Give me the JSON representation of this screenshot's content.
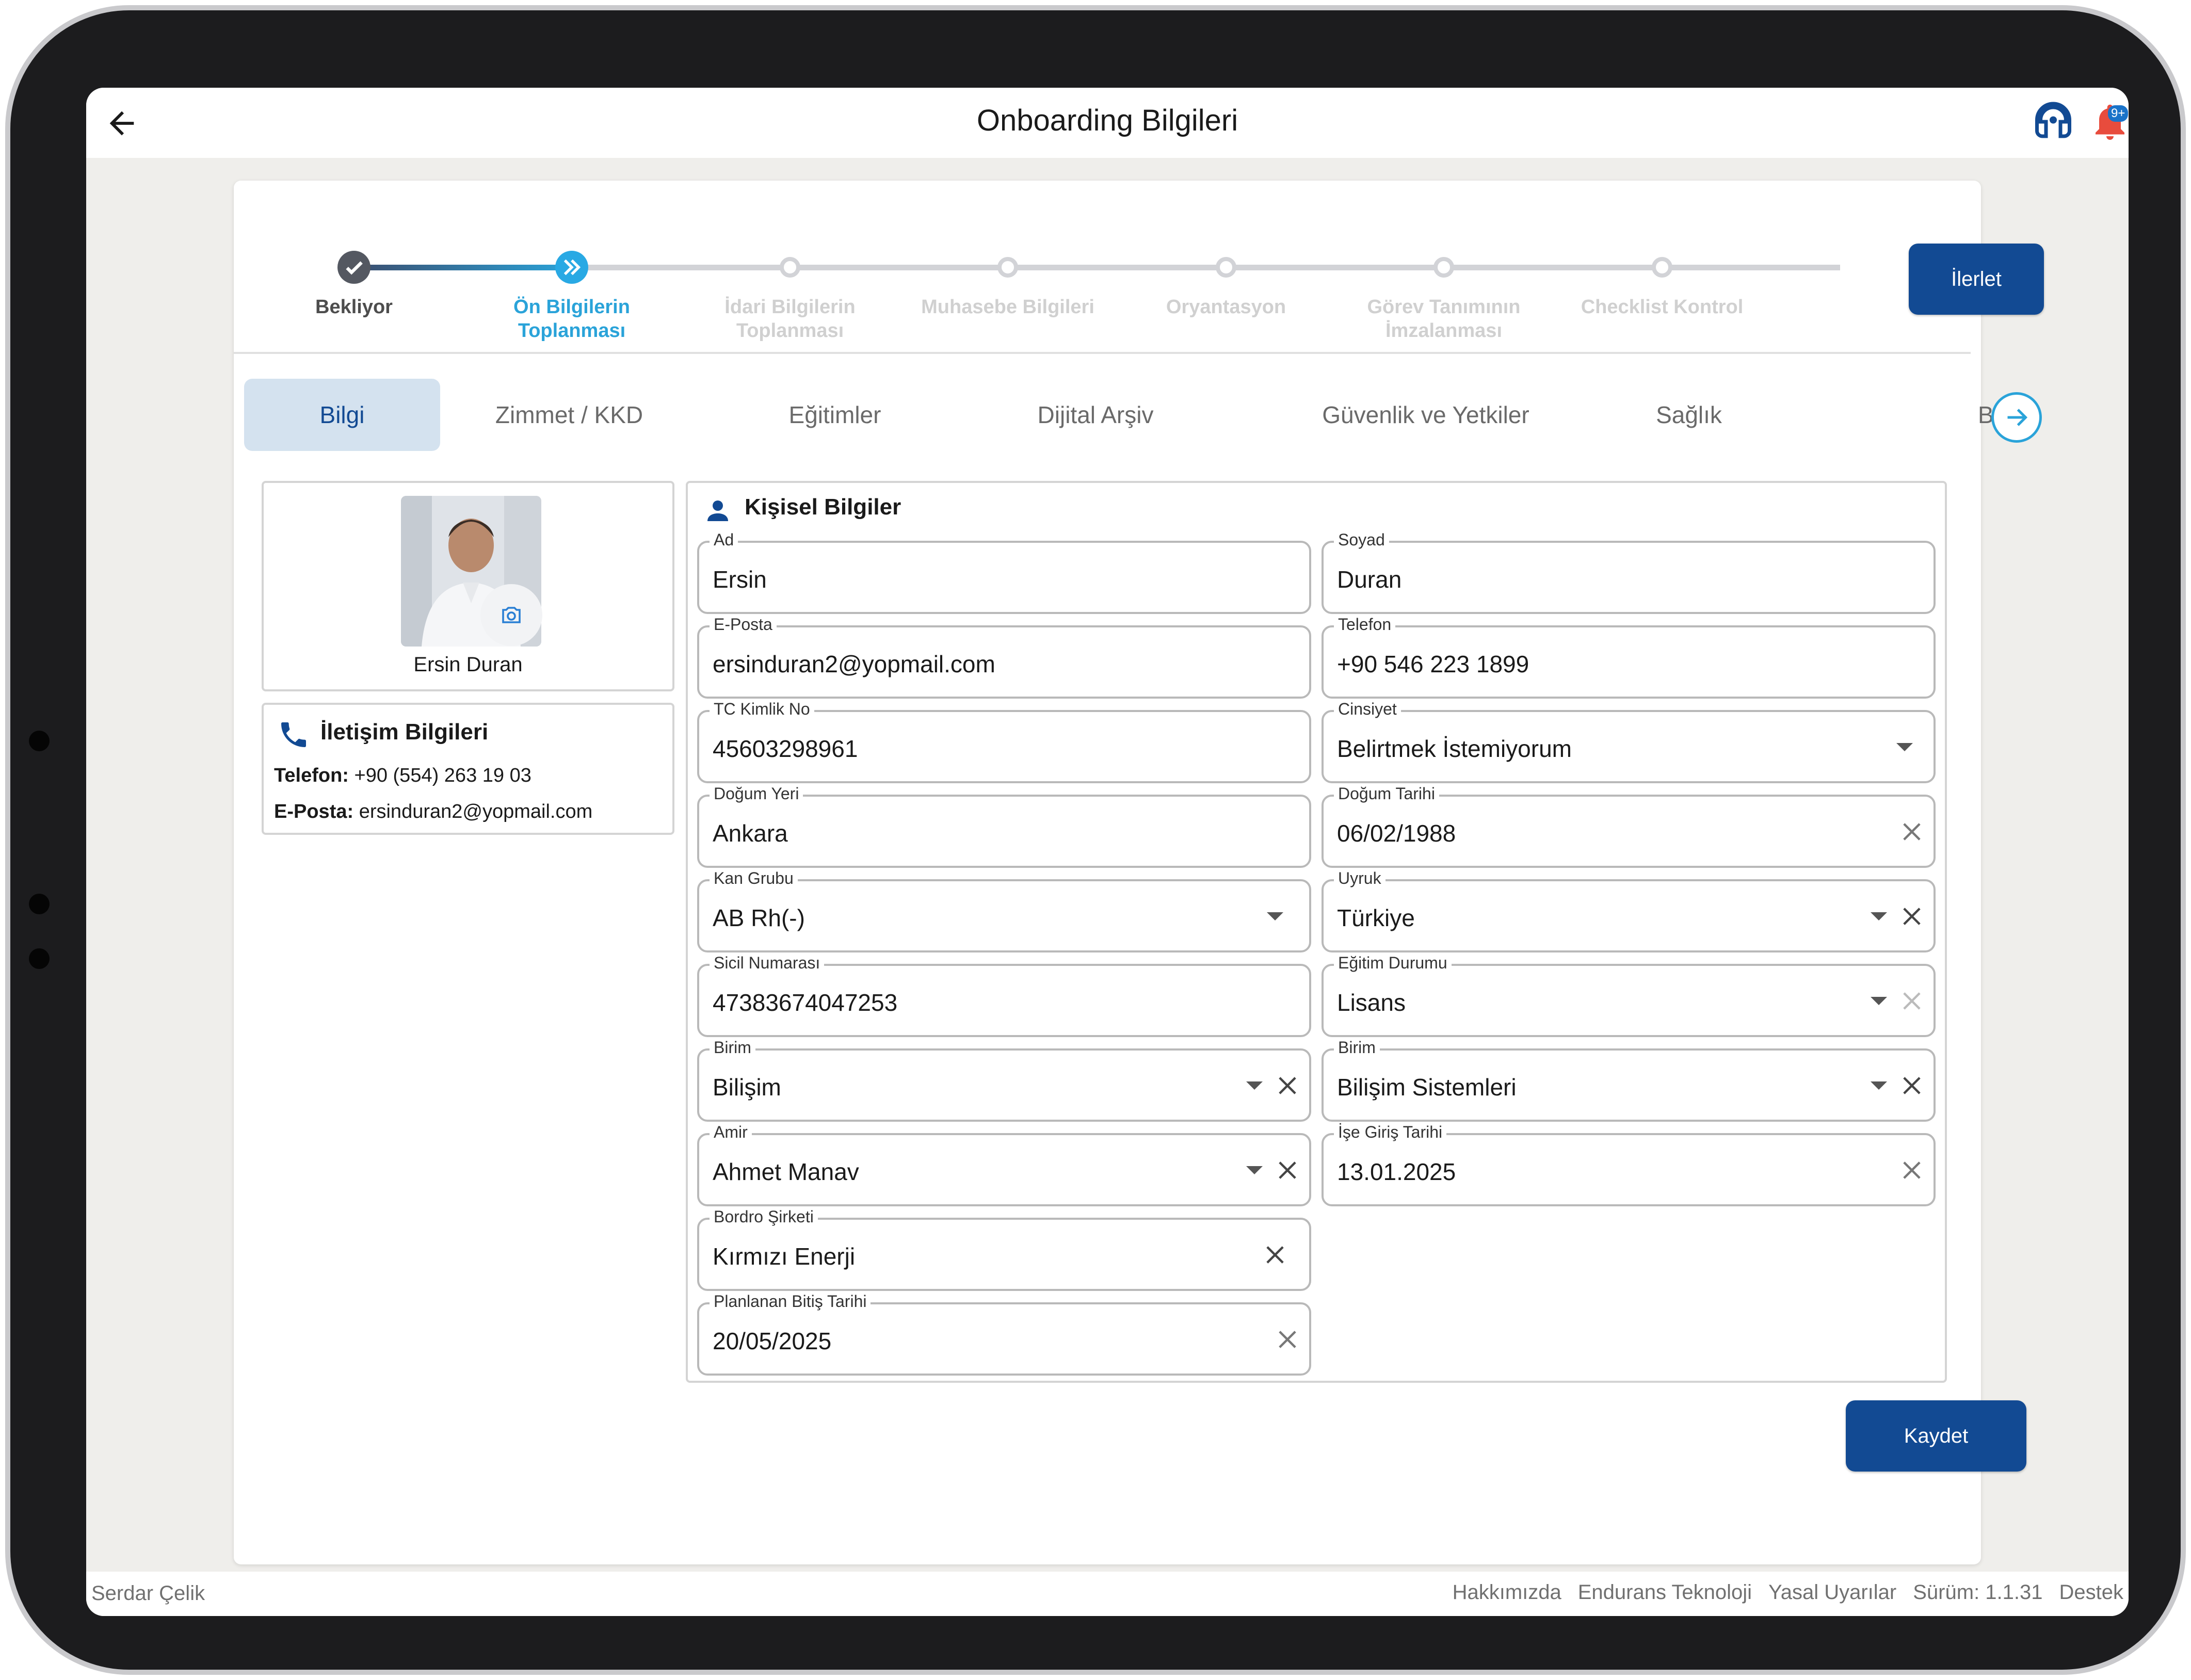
{
  "header": {
    "title": "Onboarding Bilgileri",
    "notification_badge": "9+"
  },
  "stepper": {
    "steps": [
      {
        "label": "Bekliyor",
        "status": "done"
      },
      {
        "label": "Ön Bilgilerin Toplanması",
        "status": "active"
      },
      {
        "label": "İdari Bilgilerin Toplanması",
        "status": "todo"
      },
      {
        "label": "Muhasebe Bilgileri",
        "status": "todo"
      },
      {
        "label": "Oryantasyon",
        "status": "todo"
      },
      {
        "label": "Görev Tanımının İmzalanması",
        "status": "todo"
      },
      {
        "label": "Checklist Kontrol",
        "status": "todo"
      }
    ],
    "advance_label": "İlerlet"
  },
  "tabs": [
    {
      "label": "Bilgi",
      "active": true
    },
    {
      "label": "Zimmet / KKD",
      "active": false
    },
    {
      "label": "Eğitimler",
      "active": false
    },
    {
      "label": "Dijital Arşiv",
      "active": false
    },
    {
      "label": "Güvenlik ve Yetkiler",
      "active": false
    },
    {
      "label": "Sağlık",
      "active": false
    },
    {
      "label": "B",
      "active": false
    }
  ],
  "profile": {
    "name": "Ersin Duran"
  },
  "contact": {
    "title": "İletişim Bilgileri",
    "phone_label": "Telefon:",
    "phone": "+90 (554) 263 19 03",
    "email_label": "E-Posta:",
    "email": "ersinduran2@yopmail.com"
  },
  "personal": {
    "title": "Kişisel Bilgiler",
    "fields": [
      {
        "label": "Ad",
        "value": "Ersin"
      },
      {
        "label": "Soyad",
        "value": "Duran"
      },
      {
        "label": "E-Posta",
        "value": "ersinduran2@yopmail.com"
      },
      {
        "label": "Telefon",
        "value": "+90 546 223 1899"
      },
      {
        "label": "TC Kimlik No",
        "value": "45603298961"
      },
      {
        "label": "Cinsiyet",
        "value": "Belirtmek İstemiyorum"
      },
      {
        "label": "Doğum Yeri",
        "value": "Ankara"
      },
      {
        "label": "Doğum Tarihi",
        "value": "06/02/1988"
      },
      {
        "label": "Kan Grubu",
        "value": "AB Rh(-)"
      },
      {
        "label": "Uyruk",
        "value": "Türkiye"
      },
      {
        "label": "Sicil Numarası",
        "value": "47383674047253"
      },
      {
        "label": "Eğitim Durumu",
        "value": "Lisans"
      },
      {
        "label": "Birim",
        "value": "Bilişim"
      },
      {
        "label": "Birim",
        "value": "Bilişim Sistemleri"
      },
      {
        "label": "Amir",
        "value": "Ahmet Manav"
      },
      {
        "label": "İşe Giriş Tarihi",
        "value": "13.01.2025"
      },
      {
        "label": "Bordro Şirketi",
        "value": "Kırmızı Enerji"
      },
      {
        "label": "Planlanan Bitiş Tarihi",
        "value": "20/05/2025"
      }
    ]
  },
  "save_label": "Kaydet",
  "footer": {
    "user": "Serdar Çelik",
    "links": [
      "Hakkımızda",
      "Endurans Teknoloji",
      "Yasal Uyarılar",
      "Sürüm: 1.1.31",
      "Destek"
    ]
  },
  "colors": {
    "primary": "#124a93",
    "accent": "#2aa3d9",
    "tab_active_bg": "#d4e2ef",
    "notification": "#e84c3d"
  },
  "icons": [
    "back-arrow-icon",
    "headset-icon",
    "bell-icon",
    "check-icon",
    "double-chevron-icon",
    "arrow-right-icon",
    "camera-icon",
    "phone-icon",
    "person-icon",
    "caret-down-icon",
    "clear-icon"
  ]
}
